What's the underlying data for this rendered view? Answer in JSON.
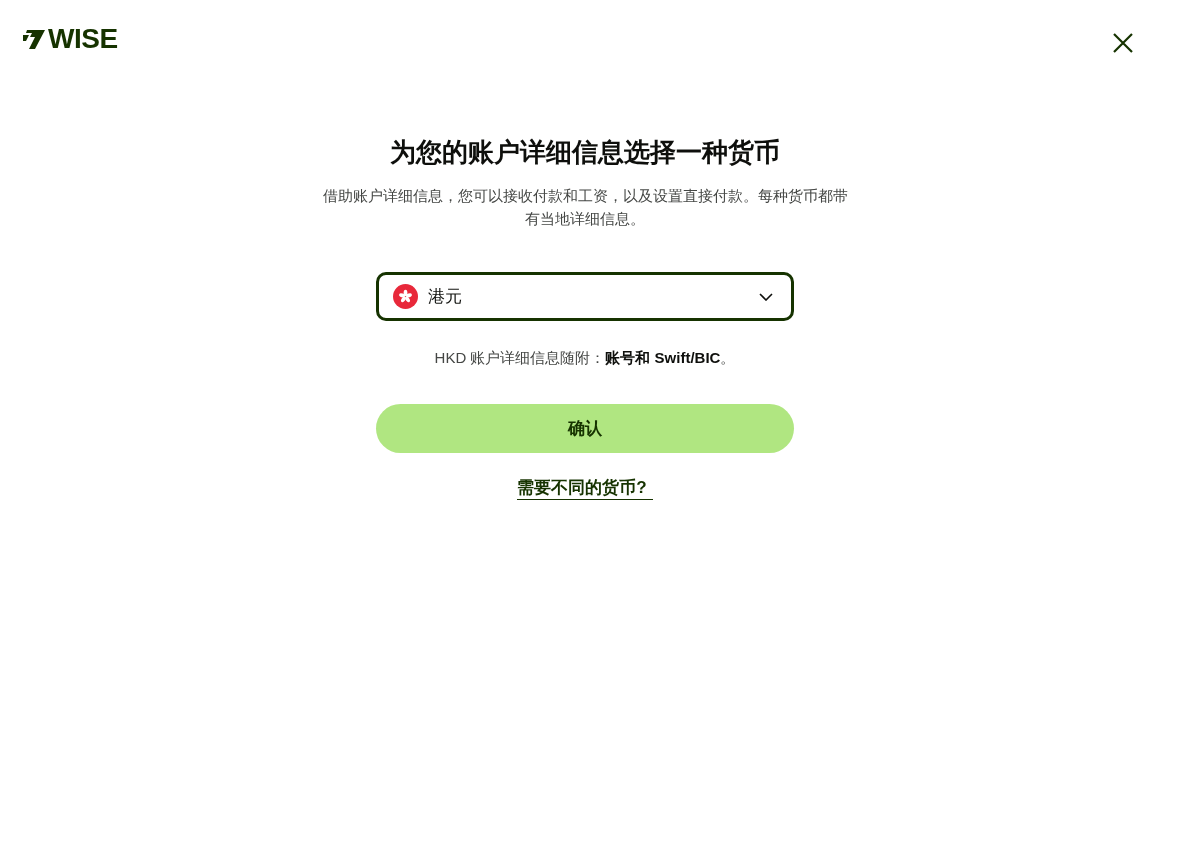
{
  "header": {
    "logo_text": "WISE"
  },
  "title": "为您的账户详细信息选择一种货币",
  "subtitle": "借助账户详细信息，您可以接收付款和工资，以及设置直接付款。每种货币都带有当地详细信息。",
  "currency_select": {
    "value": "港元"
  },
  "details_note": "HKD 账户详细信息随附：**账号和 Swift/BIC**。",
  "buttons": [
    {
      "label": "确认",
      "kind": "primary"
    },
    {
      "label": "需要不同的货币?",
      "kind": "link"
    }
  ]
}
